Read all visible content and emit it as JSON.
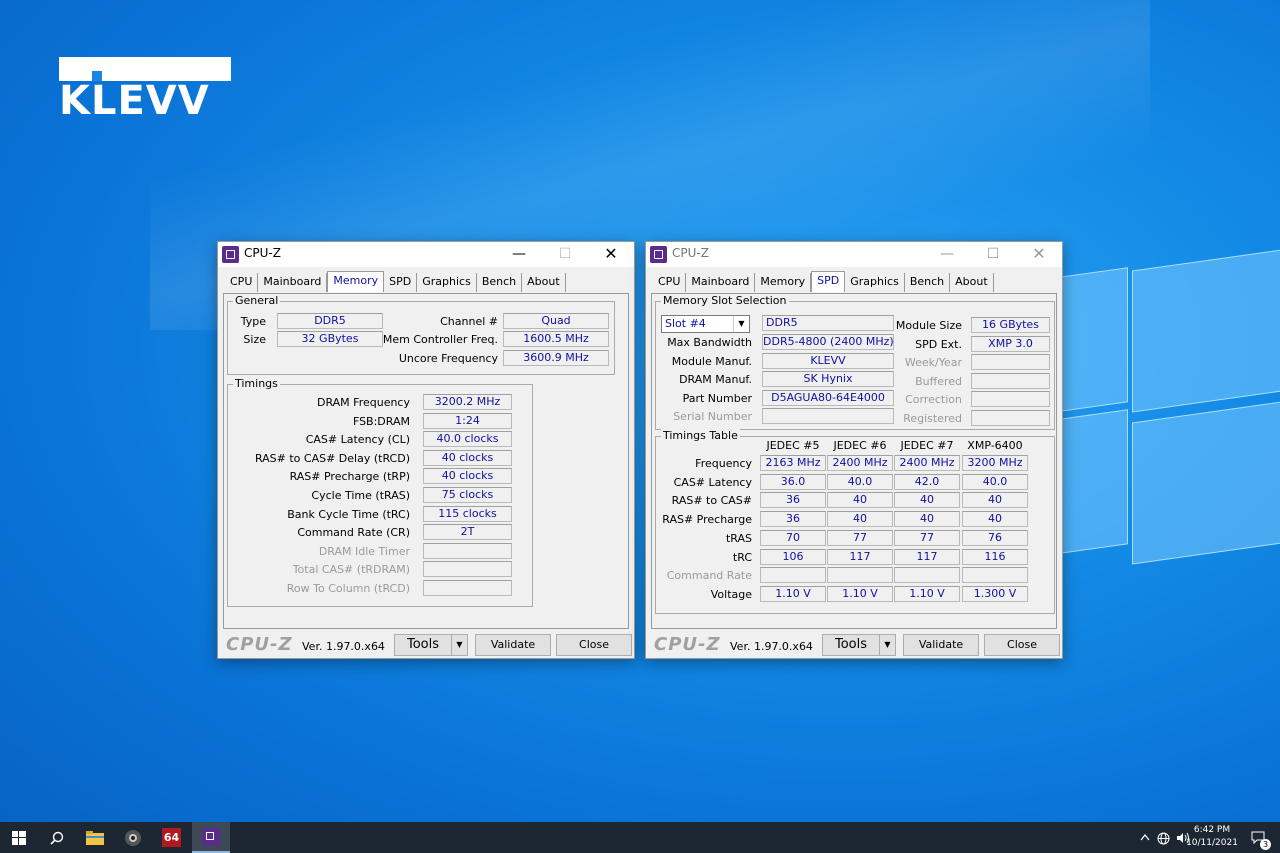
{
  "desktop": {
    "logo_text": "KLEVV"
  },
  "app_name": "CPU-Z",
  "tabs": [
    "CPU",
    "Mainboard",
    "Memory",
    "SPD",
    "Graphics",
    "Bench",
    "About"
  ],
  "window_controls": {
    "minimize": "—",
    "maximize": "☐",
    "close": "✕"
  },
  "memory_window": {
    "active_tab": "Memory",
    "general": {
      "label": "General",
      "type_label": "Type",
      "type": "DDR5",
      "size_label": "Size",
      "size": "32 GBytes",
      "channel_label": "Channel #",
      "channel": "Quad",
      "mc_freq_label": "Mem Controller Freq.",
      "mc_freq": "1600.5 MHz",
      "uncore_label": "Uncore Frequency",
      "uncore": "3600.9 MHz"
    },
    "timings": {
      "label": "Timings",
      "rows": [
        {
          "label": "DRAM Frequency",
          "value": "3200.2 MHz",
          "dim": false
        },
        {
          "label": "FSB:DRAM",
          "value": "1:24",
          "dim": false
        },
        {
          "label": "CAS# Latency (CL)",
          "value": "40.0 clocks",
          "dim": false
        },
        {
          "label": "RAS# to CAS# Delay (tRCD)",
          "value": "40 clocks",
          "dim": false
        },
        {
          "label": "RAS# Precharge (tRP)",
          "value": "40 clocks",
          "dim": false
        },
        {
          "label": "Cycle Time (tRAS)",
          "value": "75 clocks",
          "dim": false
        },
        {
          "label": "Bank Cycle Time (tRC)",
          "value": "115 clocks",
          "dim": false
        },
        {
          "label": "Command Rate (CR)",
          "value": "2T",
          "dim": false
        },
        {
          "label": "DRAM Idle Timer",
          "value": "",
          "dim": true
        },
        {
          "label": "Total CAS# (tRDRAM)",
          "value": "",
          "dim": true
        },
        {
          "label": "Row To Column (tRCD)",
          "value": "",
          "dim": true
        }
      ]
    }
  },
  "spd_window": {
    "active_tab": "SPD",
    "slot": {
      "label": "Memory Slot Selection",
      "selected": "Slot #4",
      "type": "DDR5",
      "left_rows": [
        {
          "label": "Max Bandwidth",
          "value": "DDR5-4800 (2400 MHz)",
          "dim": false
        },
        {
          "label": "Module Manuf.",
          "value": "KLEVV",
          "dim": false
        },
        {
          "label": "DRAM Manuf.",
          "value": "SK Hynix",
          "dim": false
        },
        {
          "label": "Part Number",
          "value": "D5AGUA80-64E4000",
          "dim": false
        },
        {
          "label": "Serial Number",
          "value": "",
          "dim": true
        }
      ],
      "right_rows": [
        {
          "label": "Module Size",
          "value": "16 GBytes",
          "dim": false
        },
        {
          "label": "SPD Ext.",
          "value": "XMP 3.0",
          "dim": false
        },
        {
          "label": "Week/Year",
          "value": "",
          "dim": true
        },
        {
          "label": "Buffered",
          "value": "",
          "dim": true
        },
        {
          "label": "Correction",
          "value": "",
          "dim": true
        },
        {
          "label": "Registered",
          "value": "",
          "dim": true
        }
      ]
    },
    "timings_table": {
      "label": "Timings Table",
      "columns": [
        "JEDEC #5",
        "JEDEC #6",
        "JEDEC #7",
        "XMP-6400"
      ],
      "rows": [
        {
          "label": "Frequency",
          "values": [
            "2163 MHz",
            "2400 MHz",
            "2400 MHz",
            "3200 MHz"
          ],
          "dim": false
        },
        {
          "label": "CAS# Latency",
          "values": [
            "36.0",
            "40.0",
            "42.0",
            "40.0"
          ],
          "dim": false
        },
        {
          "label": "RAS# to CAS#",
          "values": [
            "36",
            "40",
            "40",
            "40"
          ],
          "dim": false
        },
        {
          "label": "RAS# Precharge",
          "values": [
            "36",
            "40",
            "40",
            "40"
          ],
          "dim": false
        },
        {
          "label": "tRAS",
          "values": [
            "70",
            "77",
            "77",
            "76"
          ],
          "dim": false
        },
        {
          "label": "tRC",
          "values": [
            "106",
            "117",
            "117",
            "116"
          ],
          "dim": false
        },
        {
          "label": "Command Rate",
          "values": [
            "",
            "",
            "",
            ""
          ],
          "dim": true
        },
        {
          "label": "Voltage",
          "values": [
            "1.10 V",
            "1.10 V",
            "1.10 V",
            "1.300 V"
          ],
          "dim": false
        }
      ]
    }
  },
  "footer": {
    "brand": "CPU-Z",
    "version": "Ver. 1.97.0.x64",
    "tools": "Tools",
    "validate": "Validate",
    "close": "Close"
  },
  "taskbar": {
    "clock_time": "6:42 PM",
    "clock_date": "10/11/2021",
    "notification_count": "3",
    "aida_label": "64"
  }
}
